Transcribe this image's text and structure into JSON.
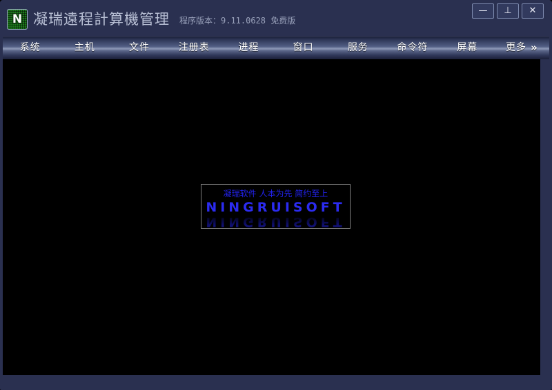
{
  "window": {
    "title": "凝瑞遠程計算機管理",
    "version_label": "程序版本：9.11.0628 免费版",
    "icon_letter": "N",
    "controls": {
      "minimize": "—",
      "maximize": "⊥",
      "close": "✕"
    },
    "colors": {
      "frame": "#2a3050",
      "title_text": "#b8bfd4",
      "version_text": "#9aa2bb",
      "content_bg": "#000000",
      "menu_text": "#ffffff",
      "logo_blue": "#2b2bf0",
      "icon_green": "#1d7a1d"
    }
  },
  "menu": {
    "items": [
      {
        "label": "系统"
      },
      {
        "label": "主机"
      },
      {
        "label": "文件"
      },
      {
        "label": "注册表"
      },
      {
        "label": "进程"
      },
      {
        "label": "窗口"
      },
      {
        "label": "服务"
      },
      {
        "label": "命令符"
      },
      {
        "label": "屏幕"
      },
      {
        "label": "更多"
      }
    ],
    "more_chevron": "»"
  },
  "logo": {
    "tagline": "凝瑞软件  人本为先  简约至上",
    "wordmark": "NINGRUISOFT",
    "reflection": "NINGRUISOFT"
  }
}
